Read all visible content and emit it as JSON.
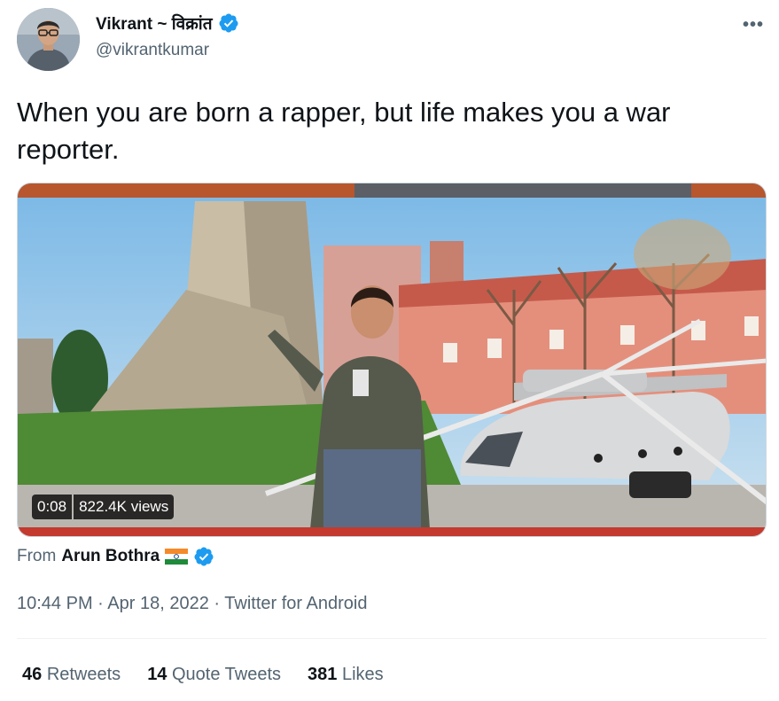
{
  "tweet": {
    "author": {
      "display_name": "Vikrant ~ विक्रांत",
      "handle": "@vikrantkumar",
      "verified": true
    },
    "more_label": "•••",
    "text": "When you are born a rapper, but life makes you a war reporter.",
    "media": {
      "duration": "0:08",
      "views": "822.4K views"
    },
    "source": {
      "from_label": "From",
      "from_name": "Arun Bothra",
      "flag": "india-flag-icon",
      "verified": true
    },
    "meta": {
      "time": "10:44 PM",
      "separator": "·",
      "date": "Apr 18, 2022",
      "client": "Twitter for Android"
    },
    "stats": {
      "retweets_count": "46",
      "retweets_label": "Retweets",
      "quotes_count": "14",
      "quotes_label": "Quote Tweets",
      "likes_count": "381",
      "likes_label": "Likes"
    }
  },
  "colors": {
    "verified": "#1d9bf0",
    "secondary_text": "#536471",
    "primary_text": "#0f1419"
  }
}
